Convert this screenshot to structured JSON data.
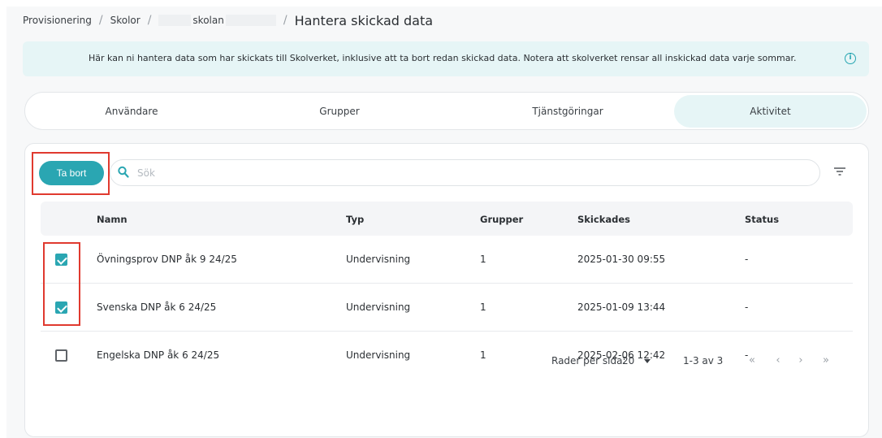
{
  "breadcrumb": {
    "items": [
      "Provisionering",
      "Skolor",
      "skolan"
    ],
    "current": "Hantera skickad data",
    "separator": "/"
  },
  "banner": {
    "text": "Här kan ni hantera data som har skickats till Skolverket, inklusive att ta bort redan skickad data. Notera att skolverket rensar all inskickad data varje sommar.",
    "icon": "info-icon"
  },
  "tabs": [
    {
      "label": "Användare",
      "active": false
    },
    {
      "label": "Grupper",
      "active": false
    },
    {
      "label": "Tjänstgöringar",
      "active": false
    },
    {
      "label": "Aktivitet",
      "active": true
    }
  ],
  "toolbar": {
    "delete_label": "Ta bort",
    "search_placeholder": "Sök",
    "search_value": ""
  },
  "table": {
    "columns": [
      "Namn",
      "Typ",
      "Grupper",
      "Skickades",
      "Status"
    ],
    "rows": [
      {
        "checked": true,
        "name": "Övningsprov DNP åk 9 24/25",
        "type": "Undervisning",
        "groups": "1",
        "sent": "2025-01-30 09:55",
        "status": "-"
      },
      {
        "checked": true,
        "name": "Svenska DNP åk 6 24/25",
        "type": "Undervisning",
        "groups": "1",
        "sent": "2025-01-09 13:44",
        "status": "-"
      },
      {
        "checked": false,
        "name": "Engelska DNP åk 6 24/25",
        "type": "Undervisning",
        "groups": "1",
        "sent": "2025-02-06 12:42",
        "status": "-"
      }
    ]
  },
  "pagination": {
    "rows_per_page_label": "Rader per sida:",
    "rows_per_page_value": "20",
    "range": "1-3 av 3",
    "first": "«",
    "prev": "‹",
    "next": "›",
    "last": "»"
  },
  "colors": {
    "accent": "#2aa6b2",
    "banner_bg": "#e6f5f6",
    "highlight_box": "#e03a2f"
  }
}
